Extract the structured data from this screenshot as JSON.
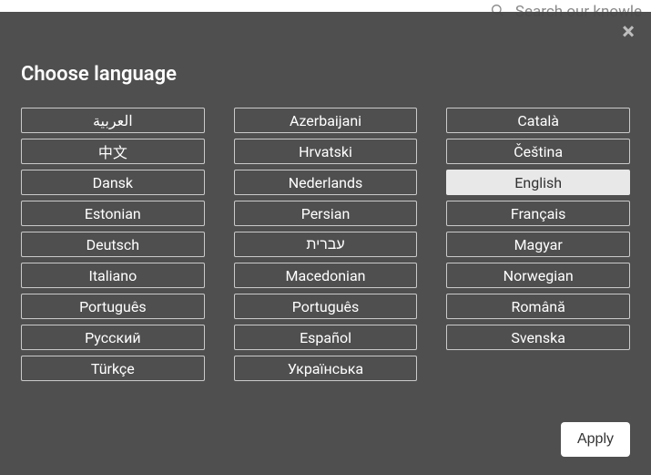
{
  "search": {
    "placeholder": "Search our knowle"
  },
  "modal": {
    "title": "Choose language",
    "apply_label": "Apply",
    "selected": "English",
    "columns": [
      [
        "العربية",
        "中文",
        "Dansk",
        "Estonian",
        "Deutsch",
        "Italiano",
        "Português",
        "Русский",
        "Türkçe"
      ],
      [
        "Azerbaijani",
        "Hrvatski",
        "Nederlands",
        "Persian",
        "עברית",
        "Macedonian",
        "Português",
        "Español",
        "Українська"
      ],
      [
        "Català",
        "Čeština",
        "English",
        "Français",
        "Magyar",
        "Norwegian",
        "Română",
        "Svenska"
      ]
    ]
  }
}
